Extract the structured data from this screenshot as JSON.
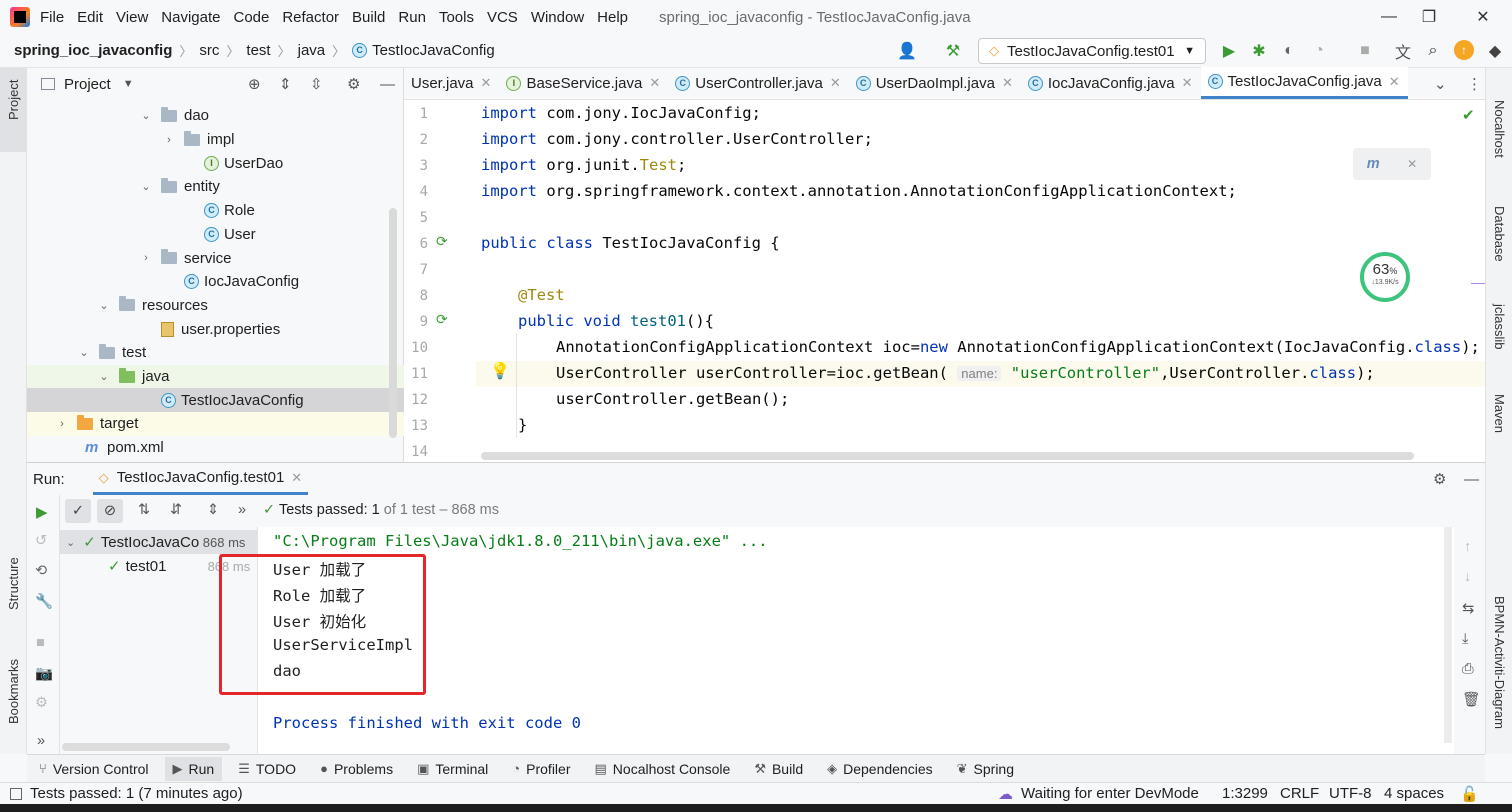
{
  "menubar": {
    "items": [
      "File",
      "Edit",
      "View",
      "Navigate",
      "Code",
      "Refactor",
      "Build",
      "Run",
      "Tools",
      "VCS",
      "Window",
      "Help"
    ],
    "title": "spring_ioc_javaconfig - TestIocJavaConfig.java"
  },
  "breadcrumb": {
    "project": "spring_ioc_javaconfig",
    "parts": [
      "src",
      "test",
      "java",
      "TestIocJavaConfig"
    ]
  },
  "run_config": {
    "label": "TestIocJavaConfig.test01"
  },
  "project_panel": {
    "title": "Project",
    "tree": [
      {
        "label": "dao",
        "arrow": "⌄",
        "icon": "folder"
      },
      {
        "label": "impl",
        "arrow": "›",
        "icon": "folder"
      },
      {
        "label": "UserDao",
        "arrow": "",
        "icon": "interface"
      },
      {
        "label": "entity",
        "arrow": "⌄",
        "icon": "folder"
      },
      {
        "label": "Role",
        "arrow": "",
        "icon": "class"
      },
      {
        "label": "User",
        "arrow": "",
        "icon": "class"
      },
      {
        "label": "service",
        "arrow": "›",
        "icon": "folder"
      },
      {
        "label": "IocJavaConfig",
        "arrow": "",
        "icon": "class"
      },
      {
        "label": "resources",
        "arrow": "⌄",
        "icon": "folder"
      },
      {
        "label": "user.properties",
        "arrow": "",
        "icon": "properties"
      },
      {
        "label": "test",
        "arrow": "⌄",
        "icon": "folder"
      },
      {
        "label": "java",
        "arrow": "⌄",
        "icon": "folder-green"
      },
      {
        "label": "TestIocJavaConfig",
        "arrow": "",
        "icon": "class"
      },
      {
        "label": "target",
        "arrow": "›",
        "icon": "folder-orange"
      },
      {
        "label": "pom.xml",
        "arrow": "",
        "icon": "maven"
      }
    ]
  },
  "editor_tabs": [
    {
      "label": "User.java",
      "icon": "",
      "active": false
    },
    {
      "label": "BaseService.java",
      "icon": "I",
      "active": false
    },
    {
      "label": "UserController.java",
      "icon": "C",
      "active": false
    },
    {
      "label": "UserDaoImpl.java",
      "icon": "C",
      "active": false
    },
    {
      "label": "IocJavaConfig.java",
      "icon": "C",
      "active": false
    },
    {
      "label": "TestIocJavaConfig.java",
      "icon": "C",
      "active": true
    }
  ],
  "editor": {
    "line_numbers": [
      "1",
      "2",
      "3",
      "4",
      "5",
      "6",
      "7",
      "8",
      "9",
      "10",
      "11",
      "12",
      "13",
      "14"
    ],
    "imports": [
      {
        "kw": "import",
        "rest": " com.jony.IocJavaConfig;"
      },
      {
        "kw": "import",
        "rest": " com.jony.controller.UserController;"
      },
      {
        "kw": "import",
        "rest": " org.junit.",
        "ann": "Test",
        "tail": ";"
      },
      {
        "kw": "import",
        "rest": " org.springframework.context.annotation.AnnotationConfigApplicationContext;"
      }
    ],
    "class_kw": "public class",
    "class_name": " TestIocJavaConfig {",
    "annotation": "@Test",
    "method_kw": "public void",
    "method_name": "test01",
    "method_tail": "(){",
    "line10_a": "AnnotationConfigApplicationContext ioc=",
    "line10_new": "new",
    "line10_b": " AnnotationConfigApplicationContext(IocJavaConfig.",
    "line10_class": "class",
    "line10_c": ");",
    "line11_a": "UserController userController=ioc.",
    "line11_meth": "getBean",
    "line11_paren": "(",
    "line11_hint": "name:",
    "line11_str": "\"userController\"",
    "line11_b": ",UserController.",
    "line11_class": "class",
    "line11_c": ");",
    "line12": "userController.getBean();",
    "line13": "}",
    "memory_widget": {
      "percent": "63",
      "unit": "%",
      "rate": "↓13.9K/s"
    }
  },
  "run_panel": {
    "label": "Run:",
    "tab": "TestIocJavaConfig.test01",
    "tests_passed_label": "Tests passed:",
    "tests_passed_count": "1",
    "tests_passed_detail": "of 1 test – 868 ms",
    "tree": [
      {
        "label": "TestIocJavaCor",
        "time": "868 ms"
      },
      {
        "label": "test01",
        "time": "868 ms"
      }
    ],
    "console": {
      "command": "\"C:\\Program Files\\Java\\jdk1.8.0_211\\bin\\java.exe\" ...",
      "lines": [
        "User 加载了",
        "Role 加载了",
        "User 初始化",
        "UserServiceImpl",
        "dao"
      ],
      "finished": "Process finished with exit code 0"
    }
  },
  "bottom_tools": [
    {
      "label": "Version Control",
      "icon": "⑂"
    },
    {
      "label": "Run",
      "icon": "▶"
    },
    {
      "label": "TODO",
      "icon": "☰"
    },
    {
      "label": "Problems",
      "icon": "●"
    },
    {
      "label": "Terminal",
      "icon": "▣"
    },
    {
      "label": "Profiler",
      "icon": "◔"
    },
    {
      "label": "Nocalhost Console",
      "icon": "▤"
    },
    {
      "label": "Build",
      "icon": "⚒"
    },
    {
      "label": "Dependencies",
      "icon": "◈"
    },
    {
      "label": "Spring",
      "icon": "❦"
    }
  ],
  "left_stripe": {
    "project": "Project",
    "structure": "Structure",
    "bookmarks": "Bookmarks"
  },
  "right_stripe": {
    "items": [
      "Nocalhost",
      "Database",
      "jclasslib",
      "Maven",
      "BPMN-Activiti-Diagram"
    ]
  },
  "statusbar": {
    "tests": "Tests passed: 1 (7 minutes ago)",
    "devmode": "Waiting for enter DevMode",
    "position": "1:3299",
    "line_sep": "CRLF",
    "encoding": "UTF-8",
    "indent": "4 spaces"
  }
}
